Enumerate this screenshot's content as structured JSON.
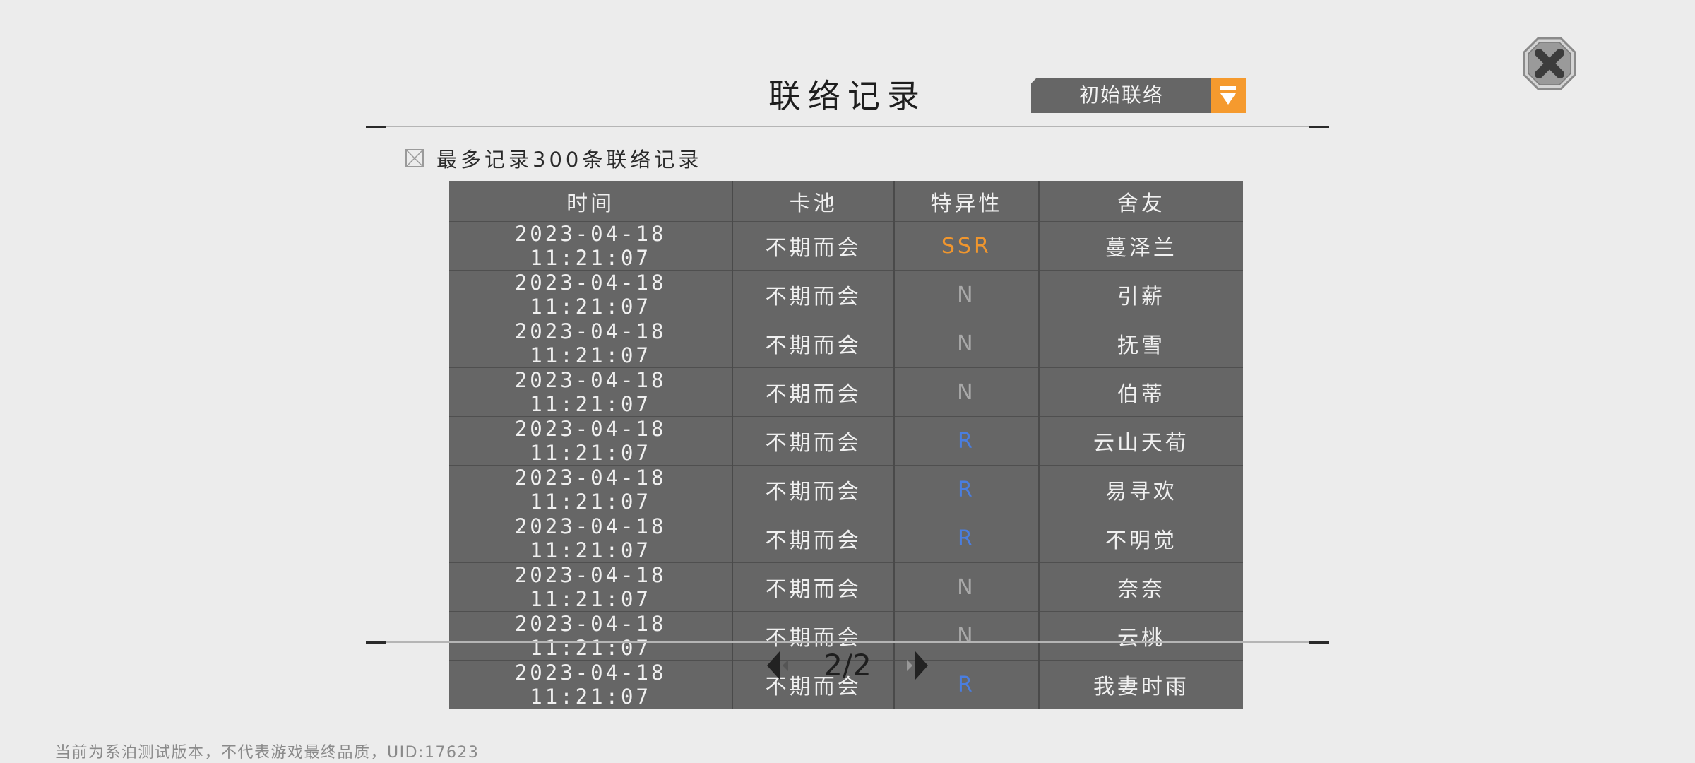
{
  "close_icon": "close-icon",
  "title": "联络记录",
  "pool_dropdown": {
    "label": "初始联络",
    "icon": "chevron-down-icon",
    "accent": "#f59a2e"
  },
  "note": {
    "text": "最多记录300条联络记录",
    "icon": "checkbox-icon"
  },
  "table": {
    "headers": [
      "时间",
      "卡池",
      "特异性",
      "舍友"
    ],
    "rows": [
      {
        "time": "2023-04-18 11:21:07",
        "pool": "不期而会",
        "rarity": "SSR",
        "friend": "蔓泽兰"
      },
      {
        "time": "2023-04-18 11:21:07",
        "pool": "不期而会",
        "rarity": "N",
        "friend": "引薪"
      },
      {
        "time": "2023-04-18 11:21:07",
        "pool": "不期而会",
        "rarity": "N",
        "friend": "抚雪"
      },
      {
        "time": "2023-04-18 11:21:07",
        "pool": "不期而会",
        "rarity": "N",
        "friend": "伯蒂"
      },
      {
        "time": "2023-04-18 11:21:07",
        "pool": "不期而会",
        "rarity": "R",
        "friend": "云山天荀"
      },
      {
        "time": "2023-04-18 11:21:07",
        "pool": "不期而会",
        "rarity": "R",
        "friend": "易寻欢"
      },
      {
        "time": "2023-04-18 11:21:07",
        "pool": "不期而会",
        "rarity": "R",
        "friend": "不明觉"
      },
      {
        "time": "2023-04-18 11:21:07",
        "pool": "不期而会",
        "rarity": "N",
        "friend": "奈奈"
      },
      {
        "time": "2023-04-18 11:21:07",
        "pool": "不期而会",
        "rarity": "N",
        "friend": "云桃"
      },
      {
        "time": "2023-04-18 11:21:07",
        "pool": "不期而会",
        "rarity": "R",
        "friend": "我妻时雨"
      }
    ],
    "rarity_colors": {
      "SSR": "#f0962e",
      "R": "#4a7ee0",
      "N": "#a9a9a9"
    }
  },
  "pagination": {
    "indicator": "2/2",
    "prev_icon": "prev-page-icon",
    "next_icon": "next-page-icon"
  },
  "footer": "当前为系泊测试版本，不代表游戏最终品质，UID:17623"
}
